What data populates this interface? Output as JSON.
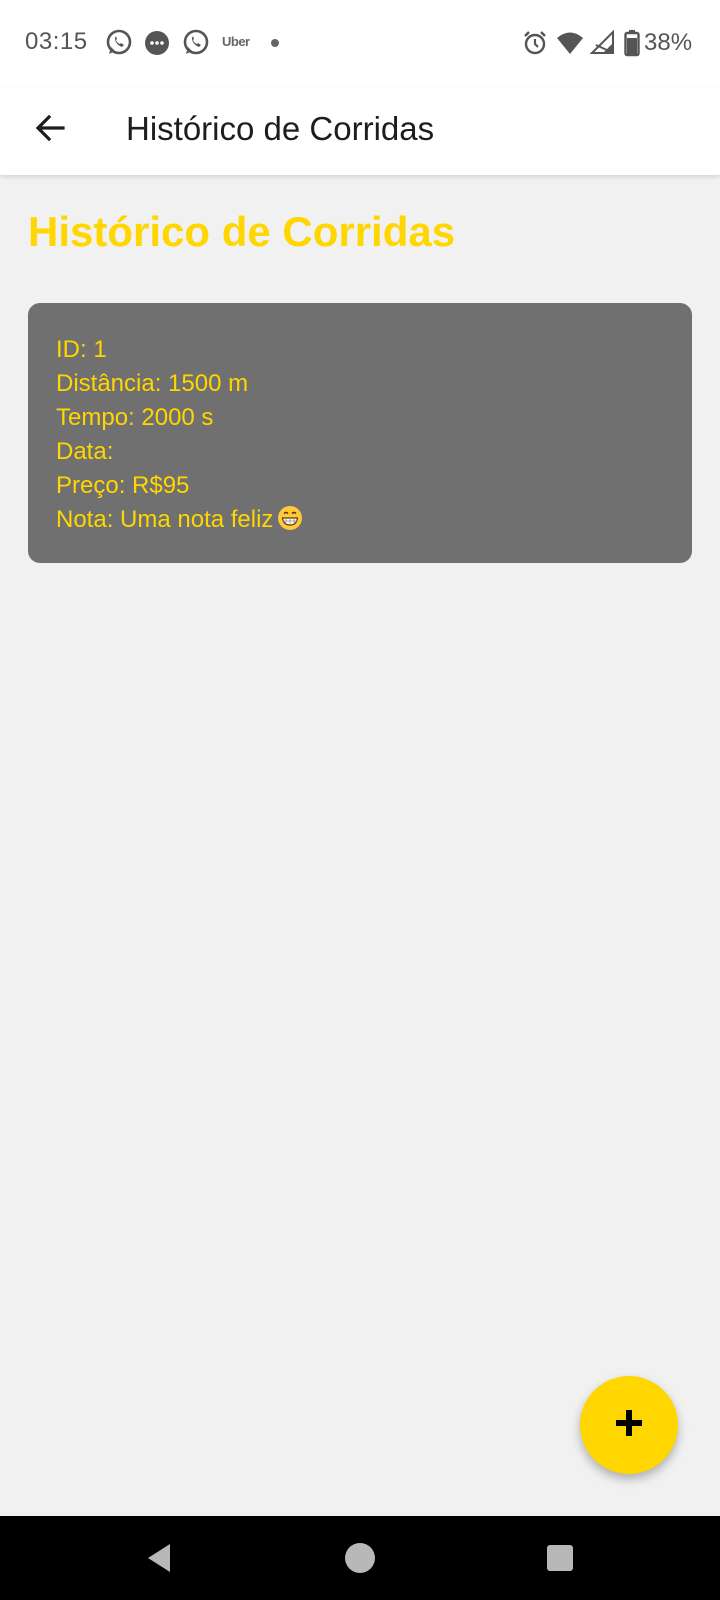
{
  "status_bar": {
    "time": "03:15",
    "notification_icons": [
      "whatsapp-icon",
      "messages-icon",
      "whatsapp-icon",
      "uber-icon"
    ],
    "uber_label": "Uber",
    "battery": "38%"
  },
  "app_bar": {
    "title": "Histórico de Corridas"
  },
  "main": {
    "heading": "Histórico de Corridas",
    "rides": [
      {
        "id_line": "ID: 1",
        "distance_line": "Distância: 1500 m",
        "time_line": "Tempo: 2000 s",
        "date_line": "Data:",
        "price_line": "Preço: R$95",
        "note_line": "Nota: Uma nota feliz",
        "note_emoji": "grinning-face-icon"
      }
    ]
  },
  "fab": {
    "icon": "plus-icon"
  },
  "colors": {
    "accent": "#ffd600",
    "card_bg": "#707070",
    "page_bg": "#f1f1f1"
  }
}
